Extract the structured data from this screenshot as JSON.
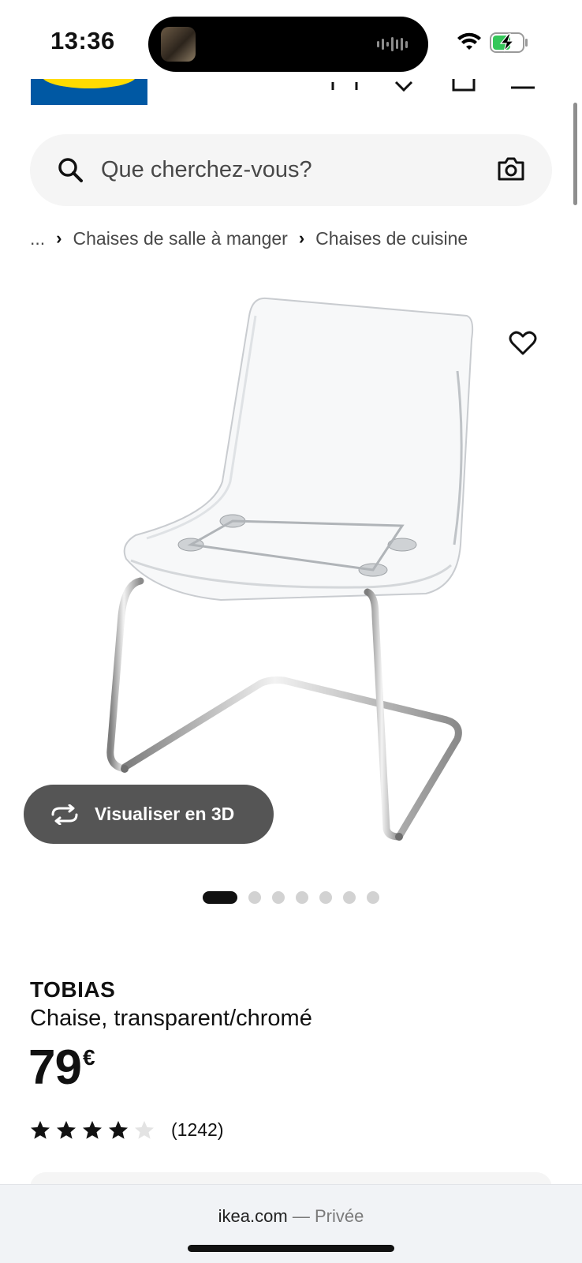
{
  "status_bar": {
    "time": "13:36",
    "icons": [
      "wifi-icon",
      "battery-charging-icon"
    ]
  },
  "header": {
    "icons": [
      "user-icon",
      "heart-icon",
      "cart-icon",
      "menu-icon"
    ]
  },
  "search": {
    "placeholder": "Que cherchez-vous?",
    "value": "",
    "icons": [
      "search-icon",
      "camera-icon"
    ]
  },
  "breadcrumb": {
    "items": [
      "...",
      "Chaises de salle à manger",
      "Chaises de cuisine"
    ]
  },
  "media": {
    "favorite_icon": "heart-outline-icon",
    "view_3d_label": "Visualiser en 3D",
    "view_3d_icon": "rotate-3d-icon",
    "carousel_total": 7,
    "carousel_active": 1
  },
  "product": {
    "name": "TOBIAS",
    "description": "Chaise, transparent/chromé",
    "price": "79",
    "currency": "€",
    "rating": 4,
    "rating_max": 5,
    "review_count": "(1242)"
  },
  "browser": {
    "domain": "ikea.com",
    "mode": "— Privée"
  },
  "colors": {
    "brand_blue": "#0058a3",
    "brand_yellow": "#ffdb00",
    "button_dark": "#555555"
  }
}
